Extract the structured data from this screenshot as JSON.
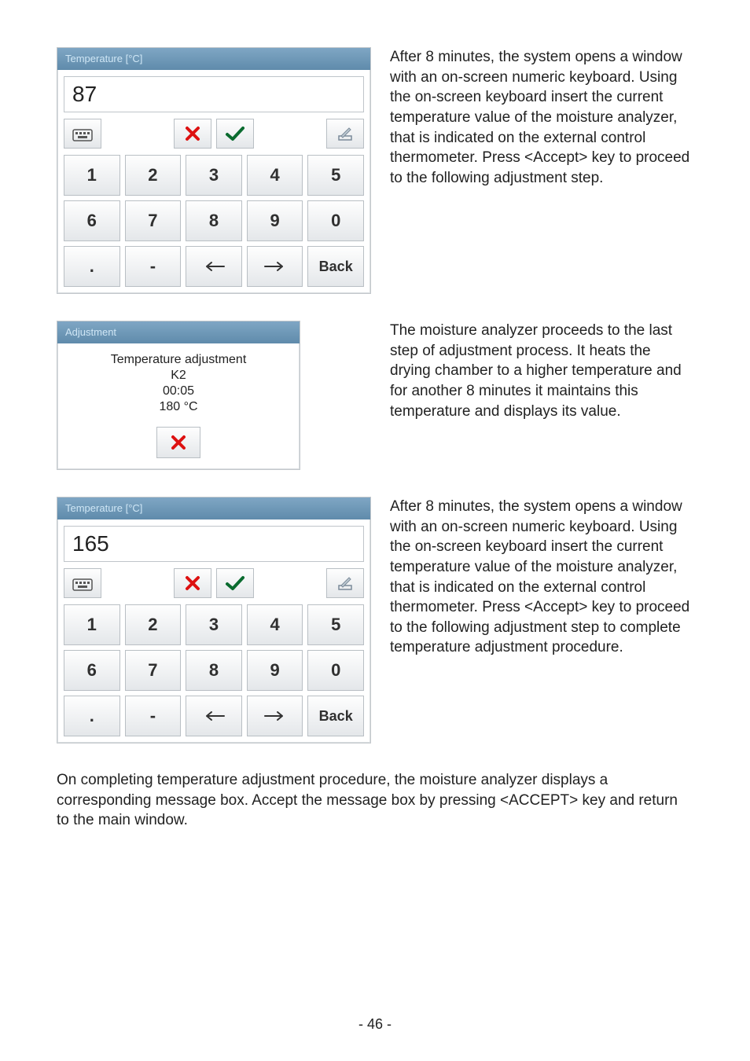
{
  "para1": "After 8 minutes, the system opens a window with an on-screen numeric keyboard. Using the on-screen keyboard insert the current temperature value of the moisture analyzer, that is indicated on the external control thermometer. Press <Accept> key to proceed to the following adjustment step.",
  "para2": "The moisture analyzer proceeds to the last step of adjustment process. It heats the drying chamber to a higher temperature and for another 8 minutes it maintains this temperature and displays its value.",
  "para3": "After 8 minutes, the system opens a window with an on-screen numeric keyboard. Using the on-screen keyboard insert the current temperature value of the moisture analyzer, that is indicated on the external control thermometer. Press <Accept> key to proceed to the following adjustment step to complete temperature adjustment procedure.",
  "footerPara": "On completing temperature adjustment procedure, the moisture analyzer displays a corresponding message box. Accept the message box by pressing <ACCEPT> key and return to the main window.",
  "keypad1": {
    "title": "Temperature [°C]",
    "value": "87",
    "keys": [
      "1",
      "2",
      "3",
      "4",
      "5",
      "6",
      "7",
      "8",
      "9",
      "0",
      ".",
      "-"
    ],
    "arrowLeft": "⟵",
    "arrowRight": "⟶",
    "back": "Back"
  },
  "adjustment": {
    "title": "Adjustment",
    "line1": "Temperature adjustment",
    "line2": "K2",
    "line3": "00:05",
    "line4": "180 °C"
  },
  "keypad2": {
    "title": "Temperature [°C]",
    "value": "165",
    "keys": [
      "1",
      "2",
      "3",
      "4",
      "5",
      "6",
      "7",
      "8",
      "9",
      "0",
      ".",
      "-"
    ],
    "arrowLeft": "⟵",
    "arrowRight": "⟶",
    "back": "Back"
  },
  "pageNumber": "- 46 -"
}
